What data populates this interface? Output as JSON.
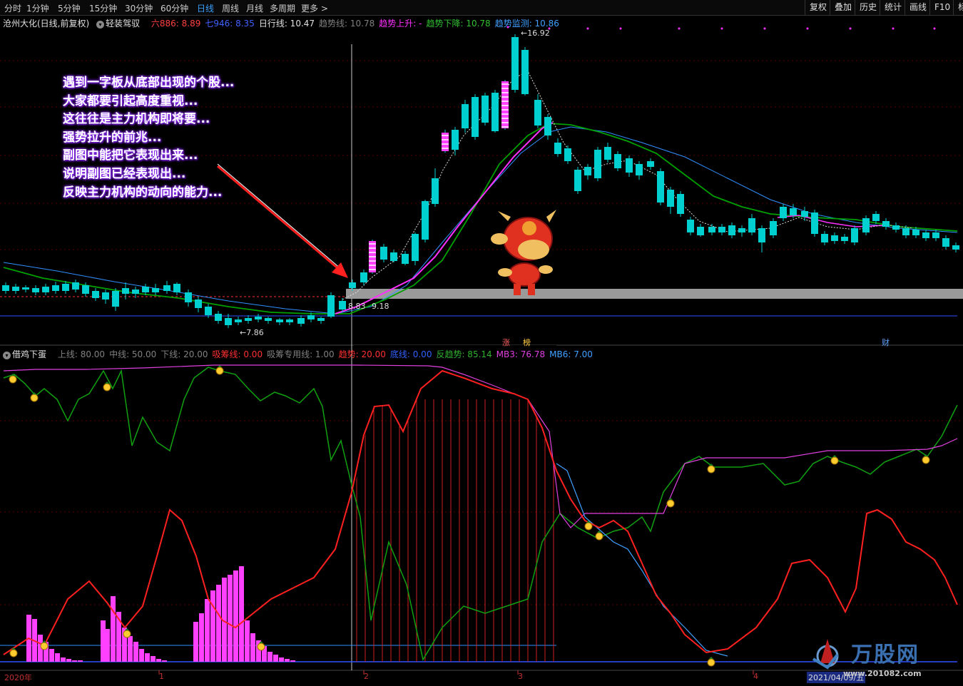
{
  "toolbar": {
    "periods": [
      "分时",
      "1分钟",
      "5分钟",
      "15分钟",
      "30分钟",
      "60分钟",
      "日线",
      "周线",
      "月线",
      "多周期",
      "更多 >"
    ],
    "active_period": "日线",
    "right_buttons": [
      "复权",
      "叠加",
      "历史",
      "统计",
      "画线",
      "F10",
      "标"
    ]
  },
  "main_info": {
    "stock": "沧州大化(日线,前复权)",
    "indicator_name": "轻装驾驭",
    "items": [
      {
        "label": "六886: 8.89",
        "color": "#ff4040"
      },
      {
        "label": "七946: 8.35",
        "color": "#4060ff"
      },
      {
        "label": "日行线: 10.47",
        "color": "#e0e0e0"
      },
      {
        "label": "趋势线: 10.78",
        "color": "#808080"
      },
      {
        "label": "趋势上升: -",
        "color": "#ff30ff"
      },
      {
        "label": "趋势下降: 10.78",
        "color": "#30c030"
      },
      {
        "label": "趋势监测: 10.86",
        "color": "#40a0ff"
      }
    ]
  },
  "price_labels": {
    "high": "16.92",
    "low": "7.86",
    "cross_a": "8.83",
    "cross_b": "9.18"
  },
  "annotation_lines": [
    "遇到一字板从底部出现的个股...",
    "大家都要引起高度重视...",
    "这往往是主力机构即将要...",
    "强势拉升的前兆...",
    "副图中能把它表现出来...",
    "说明副图已经表现出...",
    "反映主力机构的动向的能力..."
  ],
  "event_tags": [
    {
      "text": "涨",
      "color": "#ff6060"
    },
    {
      "text": "榜",
      "color": "#ffcc40"
    },
    {
      "text": "财",
      "color": "#60a0ff"
    }
  ],
  "indicator_info": {
    "name": "借鸡下蛋",
    "items": [
      {
        "label": "上线: 80.00",
        "color": "#808080"
      },
      {
        "label": "中线: 50.00",
        "color": "#808080"
      },
      {
        "label": "下线: 20.00",
        "color": "#808080"
      },
      {
        "label": "吸筹线: 0.00",
        "color": "#ff3030"
      },
      {
        "label": "吸筹专用线: 1.00",
        "color": "#808080"
      },
      {
        "label": "趋势: 20.00",
        "color": "#ff3030"
      },
      {
        "label": "底线: 0.00",
        "color": "#3060ff"
      },
      {
        "label": "反趋势: 85.14",
        "color": "#30b030"
      },
      {
        "label": "MB3: 76.78",
        "color": "#e040e0"
      },
      {
        "label": "MB6: 7.00",
        "color": "#40a0ff"
      }
    ]
  },
  "date_axis": [
    "2020年",
    "1",
    "2",
    "3",
    "4",
    "2021/04/09/五"
  ],
  "watermark": {
    "name": "万股网",
    "url": "www.201082.com"
  },
  "colors": {
    "up": "#ff3030",
    "down": "#00d0d0",
    "ma_green": "#00a000",
    "ma_blue": "#3090ff",
    "ma_magenta": "#ff30ff"
  }
}
